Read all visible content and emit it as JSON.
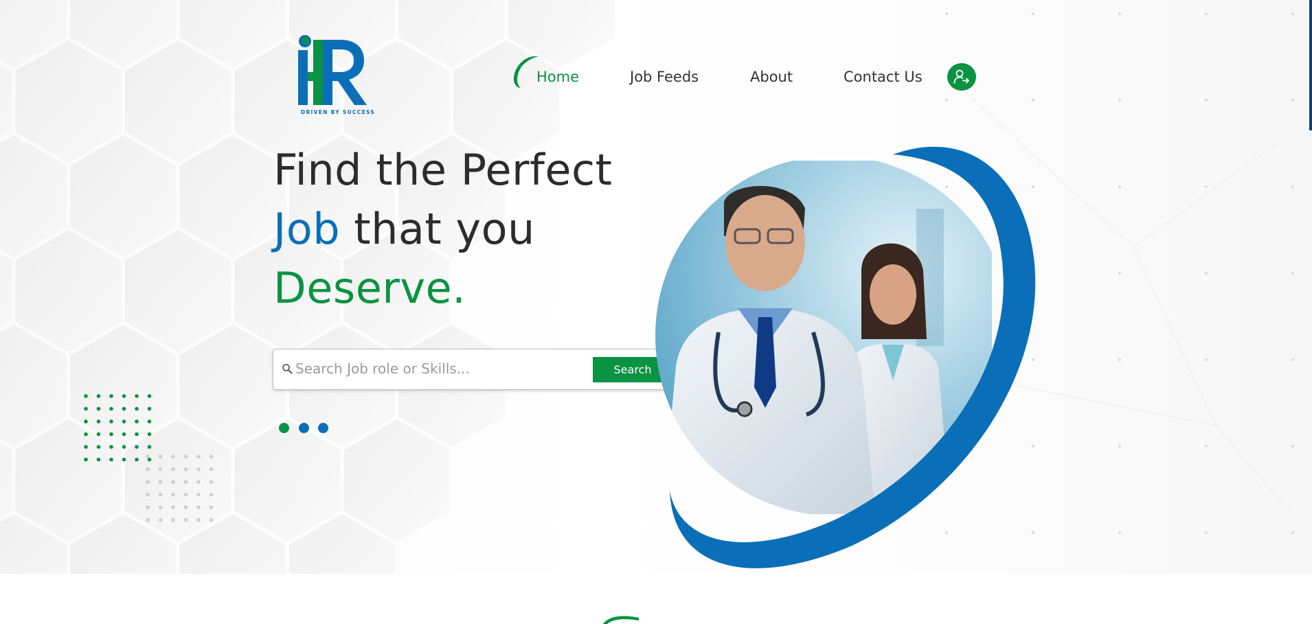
{
  "brand": {
    "logo_text": "iHR",
    "tagline": "DRIVEN BY SUCCESS",
    "colors": {
      "green": "#0a9343",
      "blue": "#0a6fb8",
      "text": "#2c2c2c"
    }
  },
  "nav": {
    "items": [
      {
        "label": "Home",
        "active": true
      },
      {
        "label": "Job Feeds",
        "active": false
      },
      {
        "label": "About",
        "active": false
      },
      {
        "label": "Contact Us",
        "active": false
      }
    ],
    "user_icon": "user-login-icon"
  },
  "hero": {
    "line1": "Find the Perfect",
    "line2_highlight": "Job",
    "line2_rest": " that you",
    "line3": "Deserve.",
    "image": "doctors-photo"
  },
  "search": {
    "placeholder": "Search Job role or Skills...",
    "button_label": "Search",
    "icon": "search-icon"
  },
  "carousel": {
    "dot_count": 3,
    "dot_colors": [
      "#0a9343",
      "#0a6fb8",
      "#0a6fb8"
    ]
  }
}
